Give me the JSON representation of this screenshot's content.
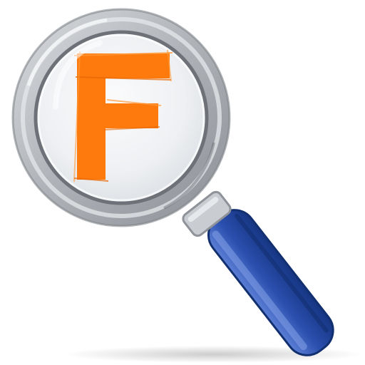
{
  "icon": {
    "name": "magnifier-f-icon",
    "lens_letter": "F",
    "colors": {
      "letter": "#ff7a0c",
      "rim": "#b9bcc0",
      "lens": "#f3f4f6",
      "handle": "#2a4fae",
      "handle_dark": "#163582"
    }
  }
}
